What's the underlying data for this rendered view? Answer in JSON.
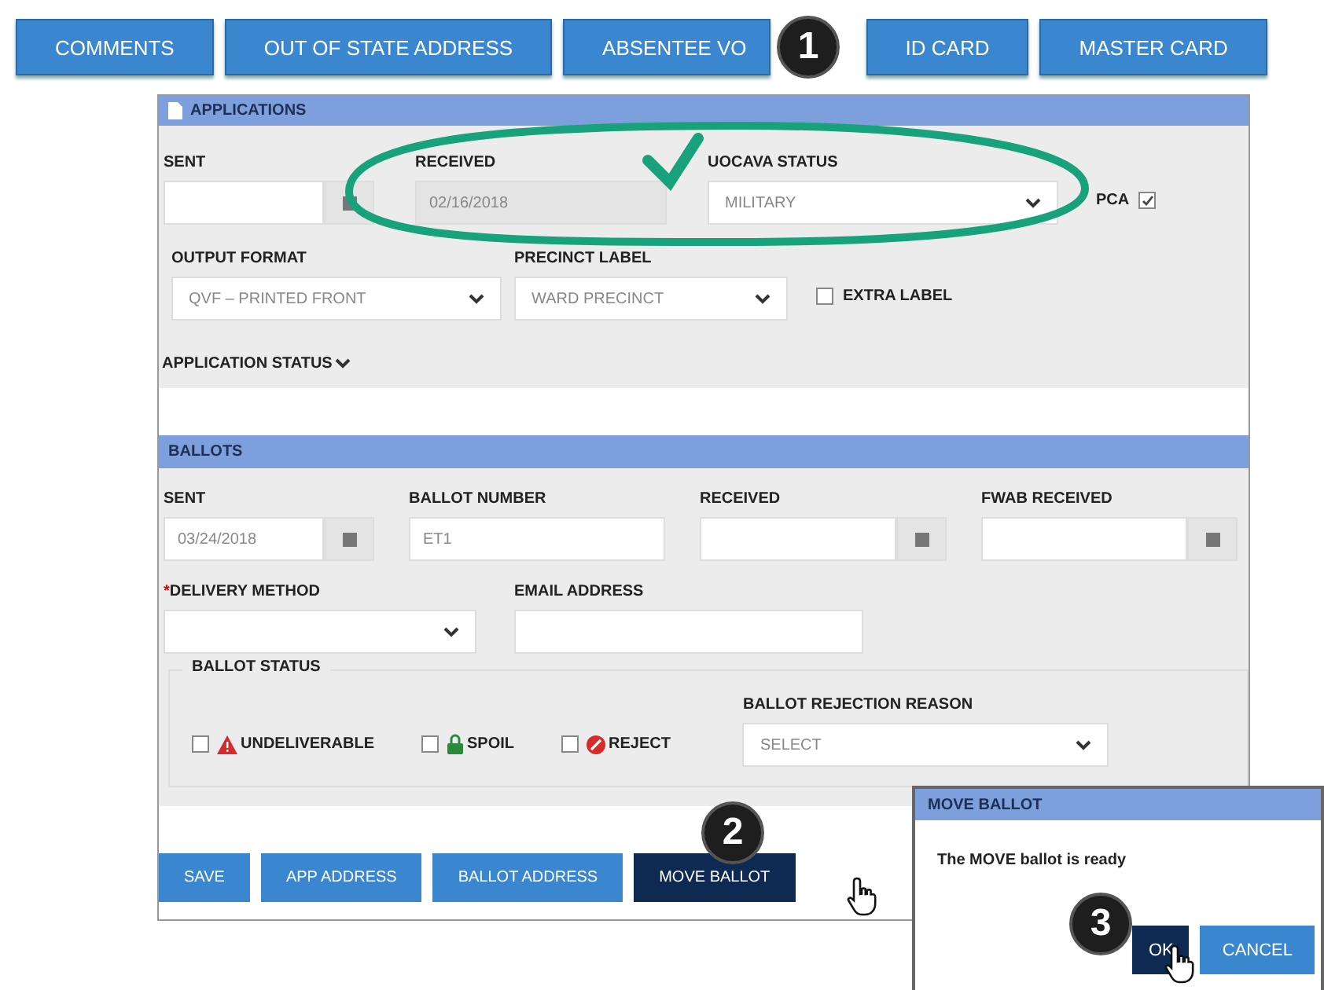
{
  "top_buttons": [
    "COMMENTS",
    "OUT OF STATE ADDRESS",
    "ABSENTEE VO",
    "ID CARD",
    "MASTER CARD"
  ],
  "applications": {
    "title": "APPLICATIONS",
    "sent": {
      "label": "SENT"
    },
    "received": {
      "label": "RECEIVED",
      "value": "02/16/2018",
      "disabled": true
    },
    "uocava_status": {
      "label": "UOCAVA STATUS",
      "value": "MILITARY"
    },
    "pca": {
      "label": "PCA",
      "checked": true
    },
    "output_format": {
      "label": "OUTPUT FORMAT",
      "value": "QVF – PRINTED FRONT"
    },
    "precinct_label": {
      "label": "PRECINCT LABEL",
      "value": "WARD PRECINCT"
    },
    "extra_label": {
      "label": "EXTRA LABEL",
      "checked": false
    },
    "application_status": {
      "label": "APPLICATION STATUS"
    }
  },
  "ballots": {
    "title": "BALLOTS",
    "sent": {
      "label": "SENT",
      "value": "03/24/2018"
    },
    "ballot_number": {
      "label": "BALLOT NUMBER",
      "value": "ET1"
    },
    "received": {
      "label": "RECEIVED"
    },
    "fwab_received": {
      "label": "FWAB RECEIVED"
    },
    "delivery_method": {
      "label": "DELIVERY METHOD",
      "required_mark": "*"
    },
    "email_address": {
      "label": "EMAIL ADDRESS"
    },
    "ballot_status": {
      "legend": "BALLOT STATUS",
      "options": [
        {
          "label": "UNDELIVERABLE",
          "kind": "warning",
          "checked": false
        },
        {
          "label": "SPOIL",
          "kind": "spoil",
          "checked": false
        },
        {
          "label": "REJECT",
          "kind": "reject",
          "checked": false
        }
      ]
    },
    "rejection_reason": {
      "label": "BALLOT REJECTION REASON",
      "placeholder": "SELECT"
    }
  },
  "buttons": [
    {
      "label": "SAVE",
      "selected": false
    },
    {
      "label": "APP ADDRESS",
      "selected": false
    },
    {
      "label": "BALLOT ADDRESS",
      "selected": false
    },
    {
      "label": "MOVE BALLOT",
      "selected": true
    }
  ],
  "dialog": {
    "title": "MOVE BALLOT",
    "message": "The MOVE ballot is ready",
    "buttons": [
      {
        "label": "OK",
        "selected": true
      },
      {
        "label": "CANCEL",
        "selected": false
      }
    ]
  },
  "callouts": [
    "1",
    "2",
    "3"
  ]
}
